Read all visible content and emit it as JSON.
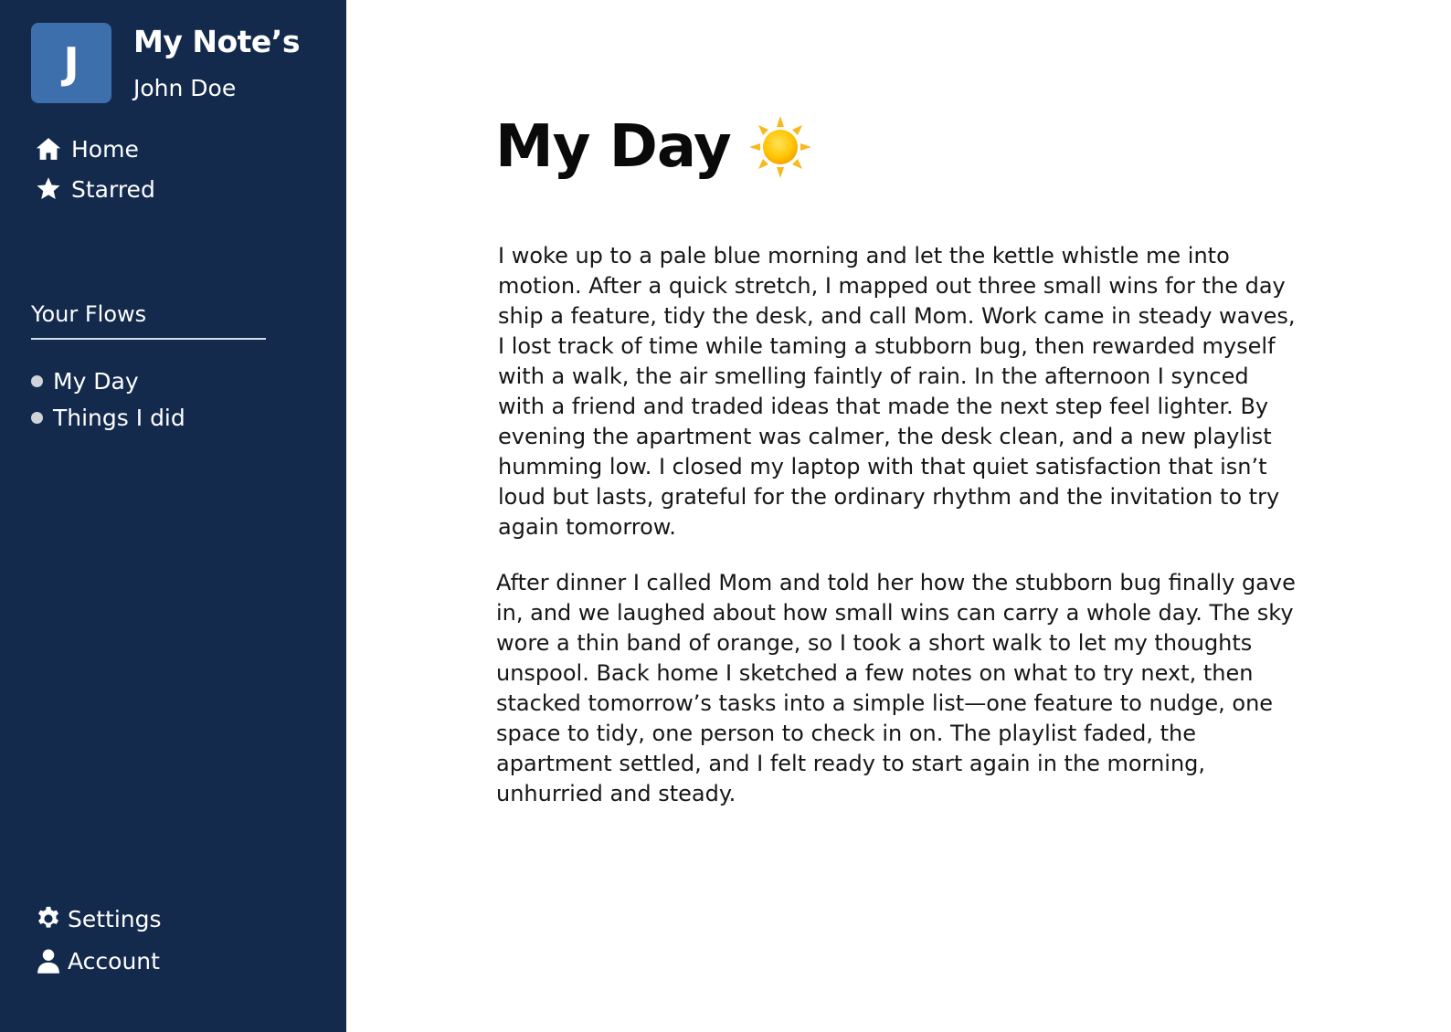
{
  "app": {
    "title": "My Note’s",
    "avatar_letter": "J",
    "user_name": "John Doe"
  },
  "sidebar": {
    "nav": [
      {
        "label": "Home",
        "icon": "home-icon"
      },
      {
        "label": "Starred",
        "icon": "star-icon"
      }
    ],
    "flows_heading": "Your Flows",
    "flows": [
      {
        "label": "My Day"
      },
      {
        "label": "Things I did"
      }
    ],
    "bottom": [
      {
        "label": "Settings",
        "icon": "gear-icon"
      },
      {
        "label": "Account",
        "icon": "user-icon"
      }
    ]
  },
  "main": {
    "title": "My Day",
    "title_icon": "sun-icon",
    "paragraphs": [
      "I woke up to a pale blue morning and let the kettle whistle me into motion. After a quick stretch, I mapped out three small wins for the day ship a feature, tidy the desk, and call Mom. Work came in steady waves, I lost track of time while taming a stubborn bug, then rewarded myself with a walk, the air smelling faintly of rain. In the afternoon I synced with a friend and traded ideas that made the next step feel lighter. By evening the apartment was calmer, the desk clean, and a new playlist humming low. I closed my laptop with that quiet satisfaction that isn’t loud but lasts, grateful for the ordinary rhythm and the invitation to try again tomorrow.",
      "After dinner I called Mom and told her how the stubborn bug finally gave in, and we laughed about how small wins can carry a whole day. The sky wore a thin band of orange, so I took a short walk to let my thoughts unspool. Back home I sketched a few notes on what to try next, then stacked tomorrow’s tasks into a simple list—one feature to nudge, one space to tidy, one person to check in on. The playlist faded, the apartment settled, and I felt ready to start again in the morning, unhurried and steady."
    ]
  },
  "colors": {
    "sidebar_bg": "#132a4c",
    "avatar_bg": "#3e6fad",
    "text_light": "#ffffff",
    "text_dark": "#111111",
    "flow_dot": "#d0d4da",
    "sun_yellow": "#ffcc00"
  }
}
